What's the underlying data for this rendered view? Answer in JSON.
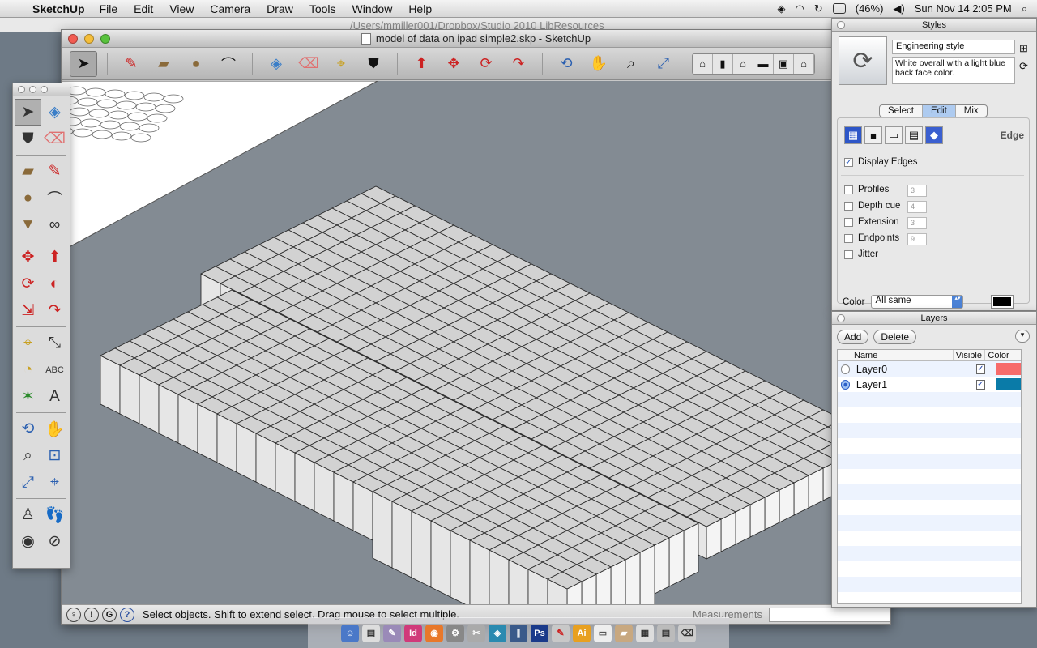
{
  "menubar": {
    "app_name": "SketchUp",
    "menus": [
      "File",
      "Edit",
      "View",
      "Camera",
      "Draw",
      "Tools",
      "Window",
      "Help"
    ],
    "battery": "(46%)",
    "datetime": "Sun Nov 14  2:05 PM"
  },
  "finder_path": "/Users/mmiller001/Dropbox/Studio 2010 LibResources",
  "window": {
    "title": "model of data on ipad simple2.skp - SketchUp"
  },
  "statusbar": {
    "hint": "Select objects. Shift to extend select. Drag mouse to select multiple.",
    "measurements_label": "Measurements"
  },
  "styles_panel": {
    "title": "Styles",
    "style_name": "Engineering style",
    "style_description": "White overall with a light blue back face color.",
    "tabs": [
      {
        "label": "Select",
        "active": false
      },
      {
        "label": "Edit",
        "active": true
      },
      {
        "label": "Mix",
        "active": false
      }
    ],
    "edit_section_title": "Edge",
    "display_edges_label": "Display Edges",
    "options": [
      {
        "label": "Profiles",
        "value": "3"
      },
      {
        "label": "Depth cue",
        "value": "4"
      },
      {
        "label": "Extension",
        "value": "3"
      },
      {
        "label": "Endpoints",
        "value": "9"
      },
      {
        "label": "Jitter",
        "value": ""
      }
    ],
    "color_label": "Color",
    "color_option": "All same",
    "color_swatch": "#000000"
  },
  "layers_panel": {
    "title": "Layers",
    "add_label": "Add",
    "delete_label": "Delete",
    "columns": [
      "Name",
      "Visible",
      "Color"
    ],
    "rows": [
      {
        "name": "Layer0",
        "active": false,
        "visible": true,
        "color": "#f76b6b"
      },
      {
        "name": "Layer1",
        "active": true,
        "visible": true,
        "color": "#0a7ba8"
      }
    ]
  },
  "colors": {
    "viewport_bg": "#838b93",
    "tile_top": "#d2d2d2",
    "tile_side": "#f4f4f4",
    "accent_blue": "#aecbf0"
  }
}
